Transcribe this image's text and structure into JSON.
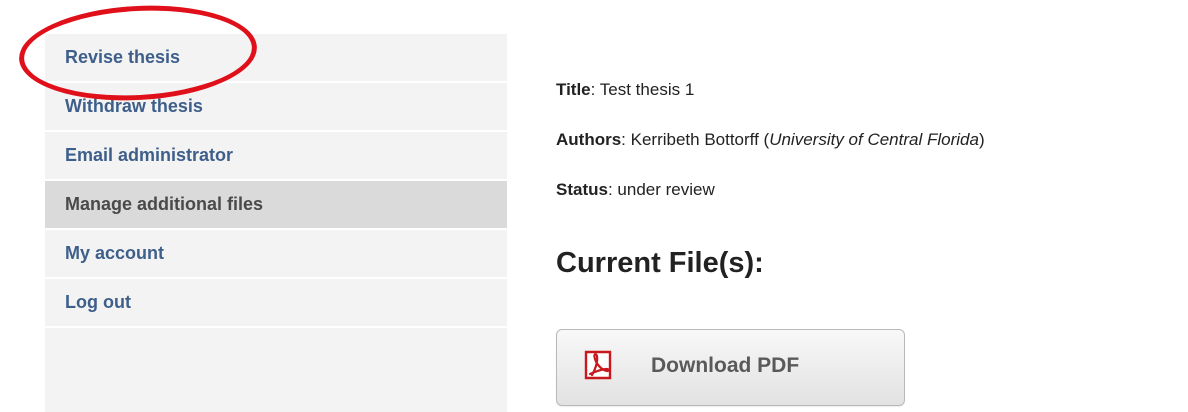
{
  "sidebar": {
    "items": [
      {
        "label": "Revise thesis"
      },
      {
        "label": "Withdraw thesis"
      },
      {
        "label": "Email administrator"
      },
      {
        "label": "Manage additional files"
      },
      {
        "label": "My account"
      },
      {
        "label": "Log out"
      }
    ]
  },
  "submission": {
    "title_key": "Title",
    "title_value": ": Test thesis 1",
    "authors_key": "Authors",
    "authors_value": ": Kerribeth Bottorff (",
    "authors_affiliation": "University of Central Florida",
    "authors_close": ")",
    "status_key": "Status",
    "status_value": ": under review"
  },
  "files": {
    "heading": "Current File(s):",
    "download_label": "Download PDF",
    "download_icon": "pdf-icon"
  },
  "colors": {
    "link": "#3e5f8a",
    "highlight_ring": "#e0101a",
    "active_item_bg": "#dadada",
    "sidebar_bg": "#f3f3f3"
  }
}
